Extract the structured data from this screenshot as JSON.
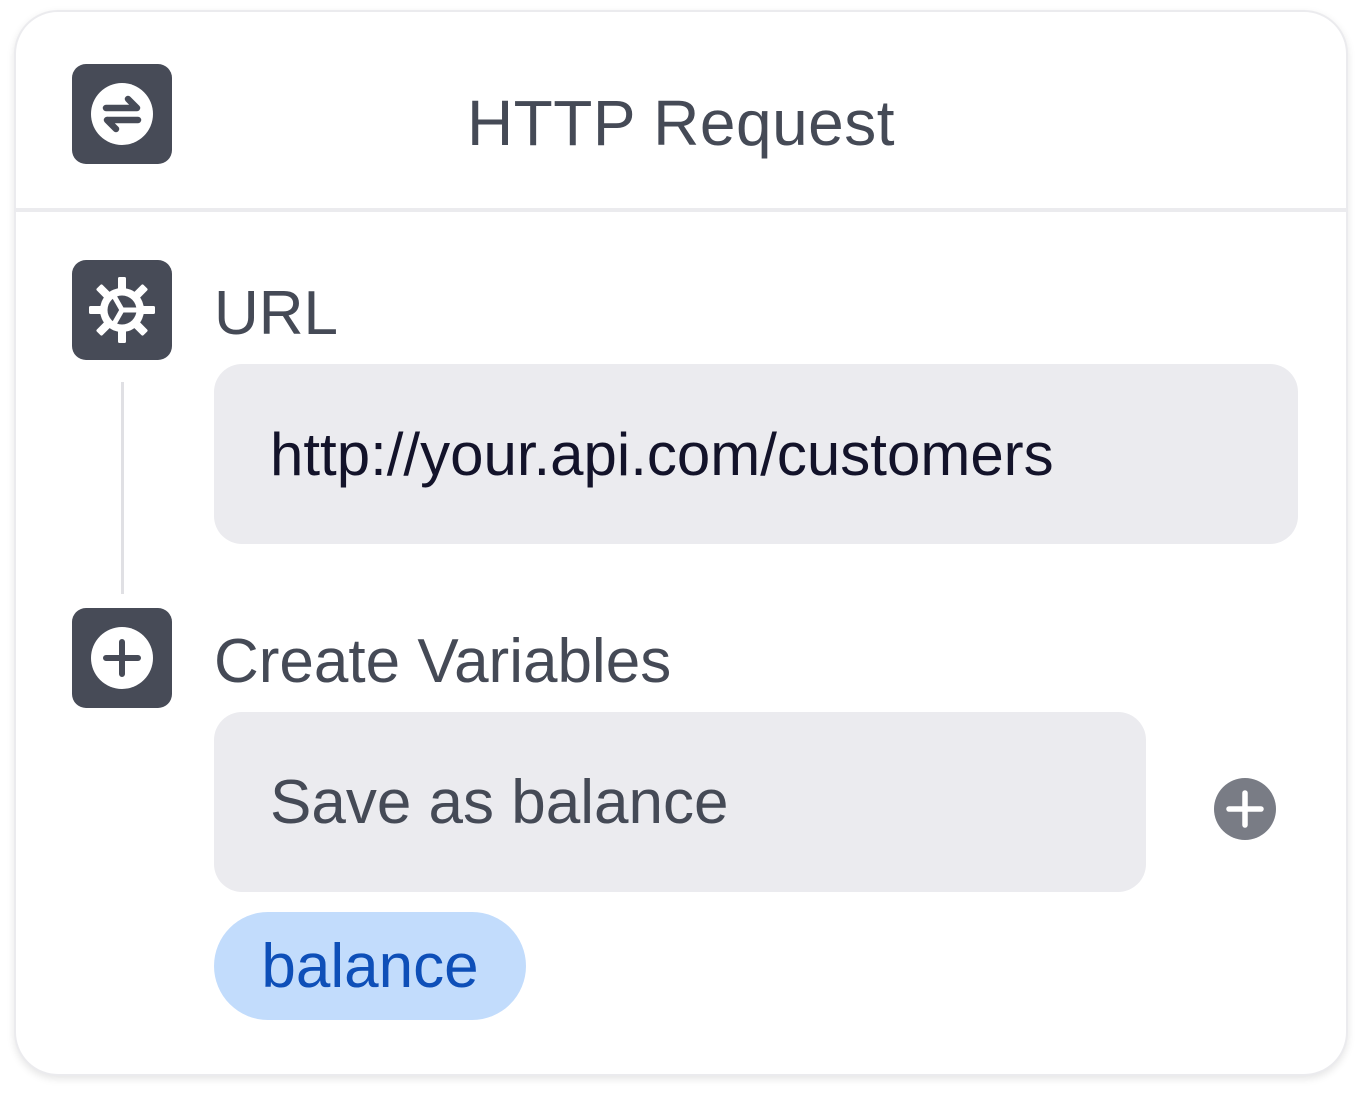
{
  "header": {
    "title": "HTTP Request",
    "icon": "swap-arrows-icon"
  },
  "steps": [
    {
      "label": "URL",
      "icon": "gear-icon",
      "value": "http://your.api.com/customers"
    },
    {
      "label": "Create Variables",
      "icon": "plus-circle-icon",
      "value": "Save as balance",
      "add_button_icon": "plus-circle-icon",
      "chip": "balance"
    }
  ],
  "colors": {
    "icon_bg": "#474b57",
    "field_bg": "#ebebef",
    "chip_bg": "#c2dcfc",
    "chip_text": "#0e4fb8",
    "add_button": "#797c85"
  }
}
